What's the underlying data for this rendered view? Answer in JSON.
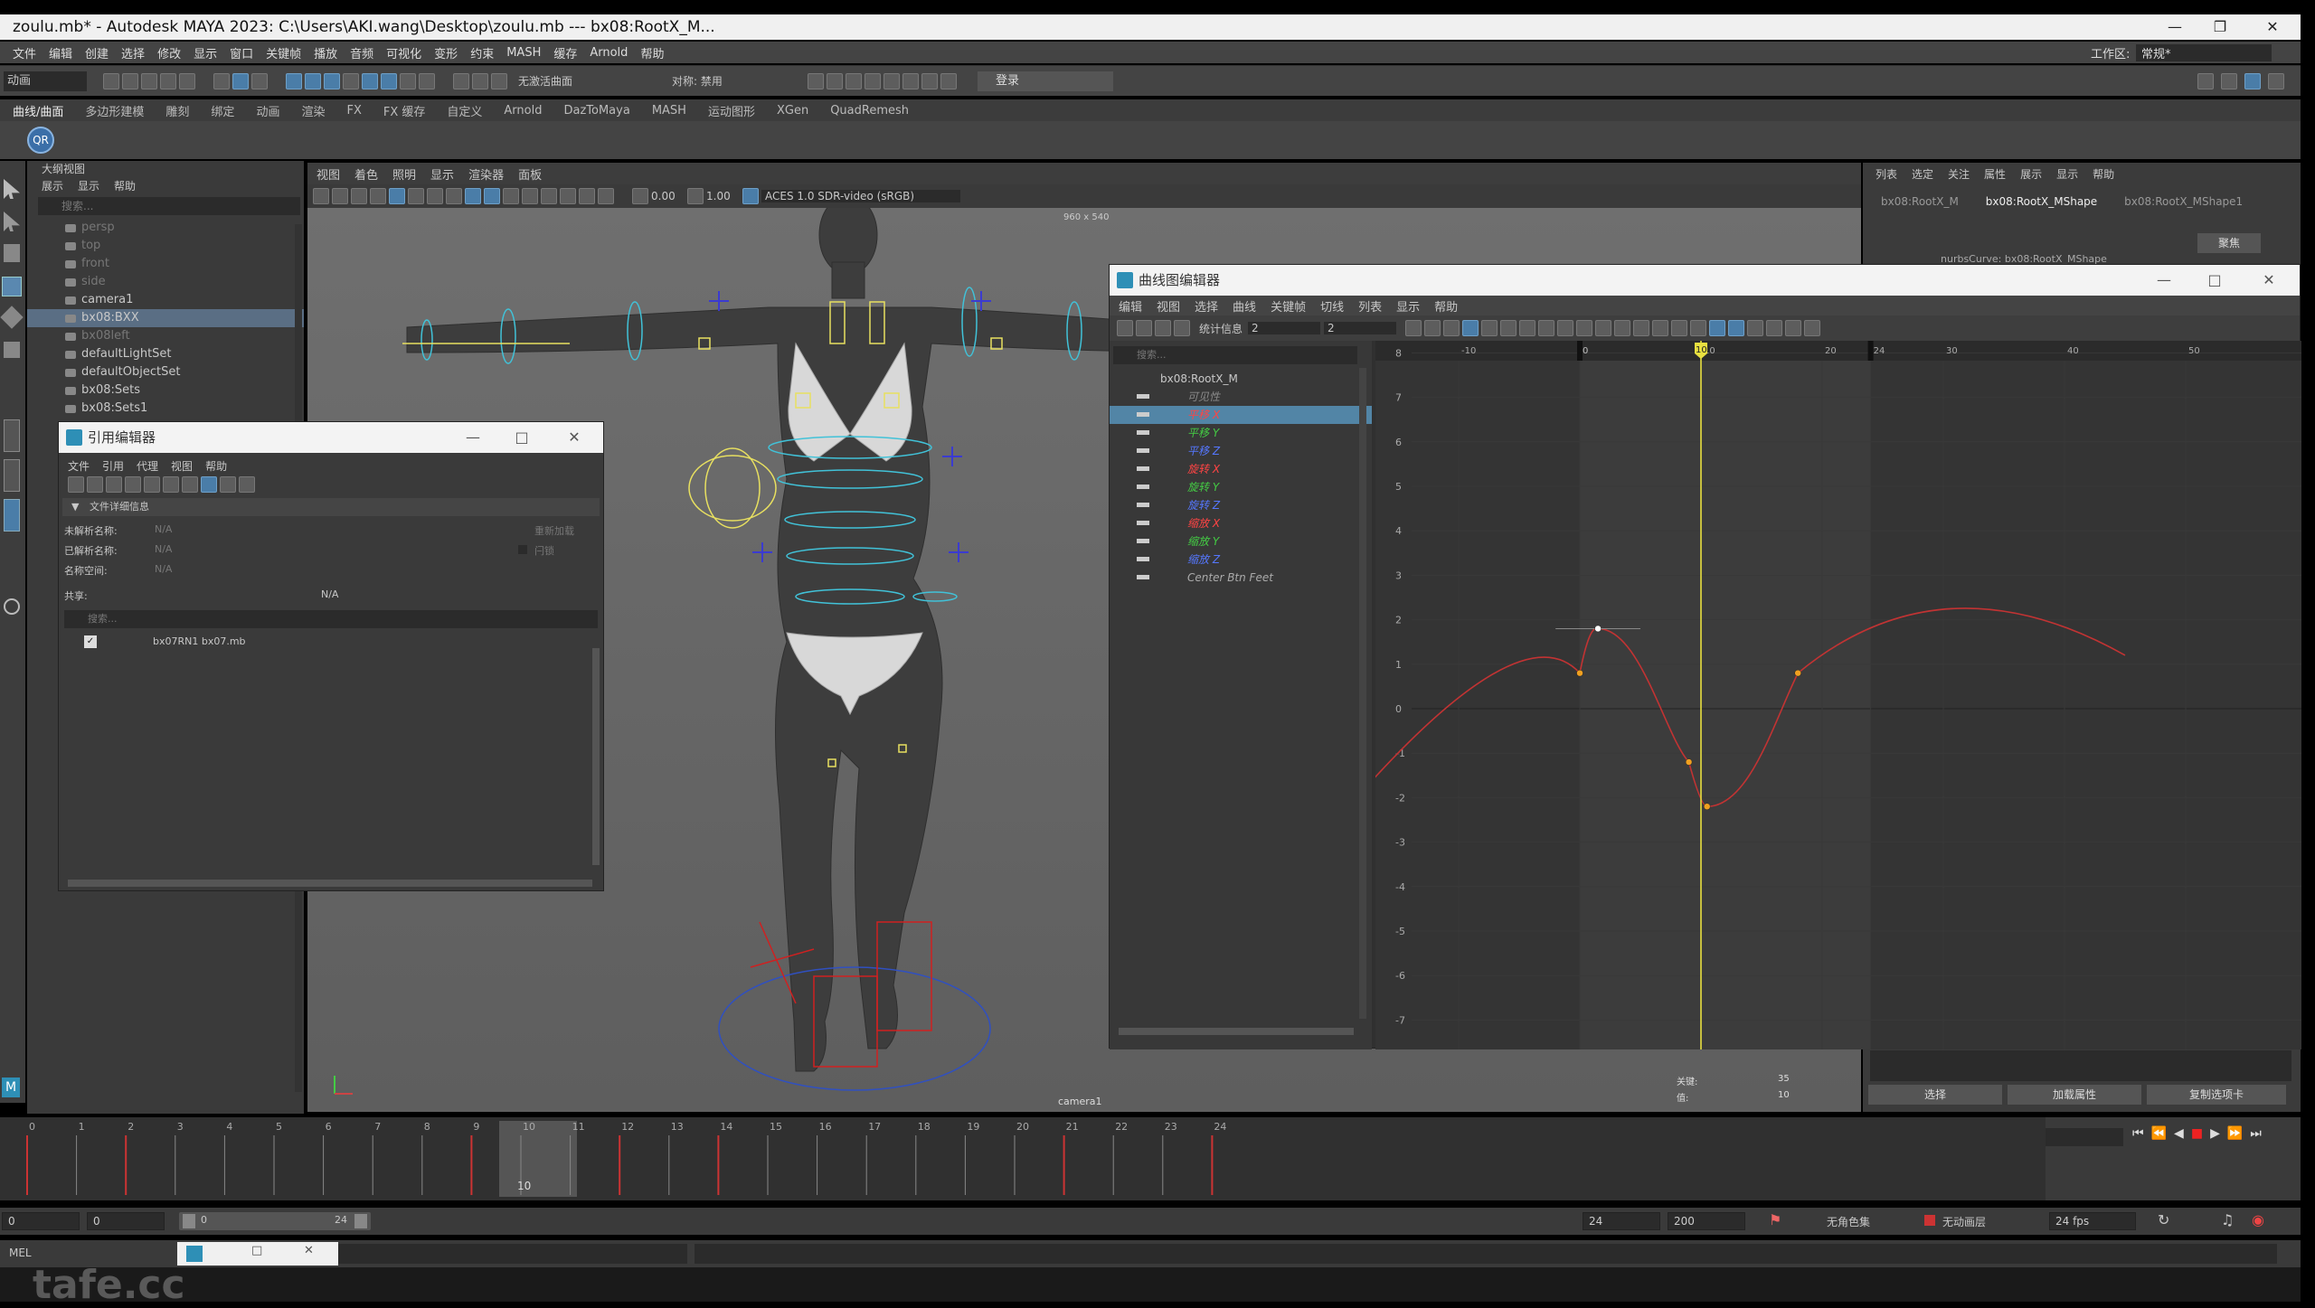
{
  "window": {
    "title": "zoulu.mb* - Autodesk MAYA 2023: C:\\Users\\AKI.wang\\Desktop\\zoulu.mb  ---  bx08:RootX_M..."
  },
  "menubar": {
    "items": [
      "文件",
      "编辑",
      "创建",
      "选择",
      "修改",
      "显示",
      "窗口",
      "关键帧",
      "播放",
      "音频",
      "可视化",
      "变形",
      "约束",
      "MASH",
      "缓存",
      "Arnold",
      "帮助"
    ],
    "workspace_label": "工作区:",
    "workspace_value": "常规*"
  },
  "statusline": {
    "mode": "动画",
    "surface": "无激活曲面",
    "symmetry": "对称: 禁用",
    "login": "登录"
  },
  "shelf": {
    "tabs": [
      "曲线/曲面",
      "多边形建模",
      "雕刻",
      "绑定",
      "动画",
      "渲染",
      "FX",
      "FX 缓存",
      "自定义",
      "Arnold",
      "DazToMaya",
      "MASH",
      "运动图形",
      "XGen",
      "QuadRemesh"
    ],
    "qr_label": "QR"
  },
  "outliner": {
    "title": "大纲视图",
    "menu": [
      "展示",
      "显示",
      "帮助"
    ],
    "search_placeholder": "搜索...",
    "items": [
      {
        "label": "persp",
        "dim": true
      },
      {
        "label": "top",
        "dim": true
      },
      {
        "label": "front",
        "dim": true
      },
      {
        "label": "side",
        "dim": true
      },
      {
        "label": "camera1",
        "dim": false
      },
      {
        "label": "bx08:BXX",
        "dim": false
      },
      {
        "label": "bx08left",
        "dim": true
      },
      {
        "label": "defaultLightSet",
        "dim": false
      },
      {
        "label": "defaultObjectSet",
        "dim": false
      },
      {
        "label": "bx08:Sets",
        "dim": false
      },
      {
        "label": "bx08:Sets1",
        "dim": false
      }
    ]
  },
  "viewport": {
    "menu": [
      "视图",
      "着色",
      "照明",
      "显示",
      "渲染器",
      "面板"
    ],
    "exposure": "0.00",
    "gamma": "1.00",
    "colorspace": "ACES 1.0 SDR-video (sRGB)",
    "resolution": "960 x 540",
    "camera_label": "camera1"
  },
  "channelbox": {
    "menu": [
      "列表",
      "选定",
      "关注",
      "属性",
      "展示",
      "显示",
      "帮助"
    ],
    "tabs": [
      "bx08:RootX_M",
      "bx08:RootX_MShape",
      "bx08:RootX_MShape1"
    ],
    "focus_button": "聚焦",
    "shape_row": "nurbsCurve:   bx08:RootX_MShape",
    "buttons": [
      "选择",
      "加载属性",
      "复制选项卡"
    ]
  },
  "reference_editor": {
    "title": "引用编辑器",
    "menu": [
      "文件",
      "引用",
      "代理",
      "视图",
      "帮助"
    ],
    "section": "文件详细信息",
    "fields": [
      {
        "label": "未解析名称:",
        "value": "N/A"
      },
      {
        "label": "已解析名称:",
        "value": "N/A"
      },
      {
        "label": "名称空间:",
        "value": "N/A"
      },
      {
        "label": "共享:",
        "value": "N/A"
      }
    ],
    "reload_button": "重新加载",
    "lock_label": "闩锁",
    "search_placeholder": "搜索...",
    "ref_entry": "bx07RN1  bx07.mb"
  },
  "graph_editor": {
    "title": "曲线图编辑器",
    "menu": [
      "编辑",
      "视图",
      "选择",
      "曲线",
      "关键帧",
      "切线",
      "列表",
      "显示",
      "帮助"
    ],
    "stats_label": "统计信息",
    "stats_value_1": "2",
    "stats_value_2": "2",
    "search_placeholder": "搜索...",
    "root_node": "bx08:RootX_M",
    "channels": [
      {
        "label": "可见性",
        "color": "#8a8a8a"
      },
      {
        "label": "平移 X",
        "color": "#ff4444"
      },
      {
        "label": "平移 Y",
        "color": "#44cc44"
      },
      {
        "label": "平移 Z",
        "color": "#5577ff"
      },
      {
        "label": "旋转 X",
        "color": "#ff4444"
      },
      {
        "label": "旋转 Y",
        "color": "#44cc44"
      },
      {
        "label": "旋转 Z",
        "color": "#5577ff"
      },
      {
        "label": "缩放 X",
        "color": "#ff4444"
      },
      {
        "label": "缩放 Y",
        "color": "#44cc44"
      },
      {
        "label": "缩放 Z",
        "color": "#5577ff"
      },
      {
        "label": "Center Btn Feet",
        "color": "#aaaaaa"
      }
    ],
    "frame_ticks": [
      "-10",
      "0",
      "0",
      "10",
      "20",
      "24",
      "30",
      "40",
      "50"
    ],
    "value_ticks": [
      "8",
      "7",
      "6",
      "5",
      "4",
      "3",
      "2",
      "1",
      "0",
      "-1",
      "-2",
      "-3",
      "-4",
      "-5",
      "-6",
      "-7"
    ],
    "current_frame": "10",
    "range_end": "24",
    "stats_frame_label": "关键:",
    "stats_frame_value": "35",
    "stats_value_label": "值:",
    "stats_value_val": "10"
  },
  "timeslider": {
    "ticks": [
      "0",
      "1",
      "2",
      "3",
      "4",
      "5",
      "6",
      "7",
      "8",
      "9",
      "10",
      "11",
      "12",
      "13",
      "14",
      "15",
      "16",
      "17",
      "18",
      "19",
      "20",
      "21",
      "22",
      "23",
      "24"
    ],
    "current_frame": "10",
    "key_frames": [
      0,
      2,
      9,
      12,
      14,
      21,
      24
    ]
  },
  "rangebar": {
    "start": "0",
    "start2": "0",
    "slider_start": "0",
    "slider_end": "24",
    "end": "24",
    "end2": "200",
    "char_set": "无角色集",
    "anim_layer": "无动画层",
    "fps": "24 fps"
  },
  "cmdline": {
    "label": "MEL"
  },
  "watermark": {
    "text": "tafe.cc"
  }
}
